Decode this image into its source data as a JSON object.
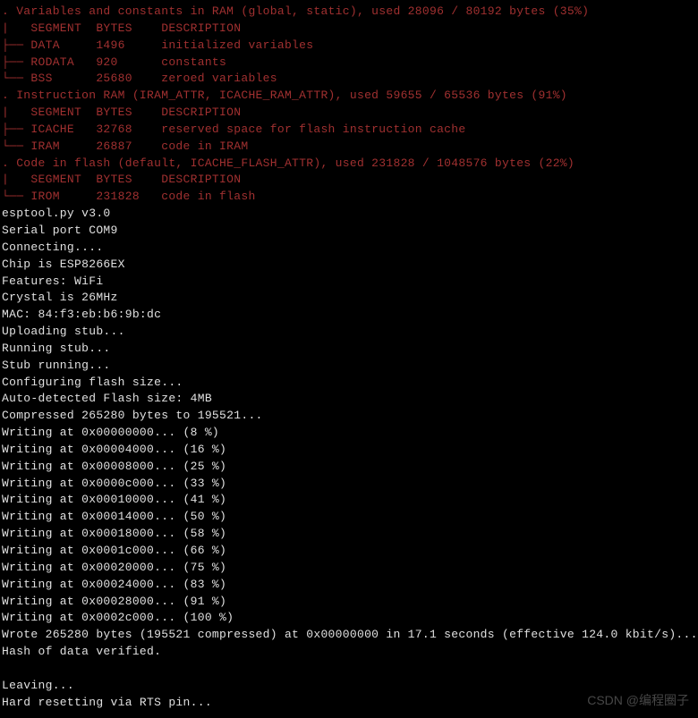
{
  "sections": [
    {
      "header": ". Variables and constants in RAM (global, static), used 28096 / 80192 bytes (35%)",
      "pipe": "|   SEGMENT  BYTES    DESCRIPTION",
      "rows": [
        {
          "prefix": "├── ",
          "seg": "DATA",
          "bytes": "1496",
          "desc": "initialized variables"
        },
        {
          "prefix": "├── ",
          "seg": "RODATA",
          "bytes": "920",
          "desc": "constants"
        },
        {
          "prefix": "└── ",
          "seg": "BSS",
          "bytes": "25680",
          "desc": "zeroed variables"
        }
      ]
    },
    {
      "header": ". Instruction RAM (IRAM_ATTR, ICACHE_RAM_ATTR), used 59655 / 65536 bytes (91%)",
      "pipe": "|   SEGMENT  BYTES    DESCRIPTION",
      "rows": [
        {
          "prefix": "├── ",
          "seg": "ICACHE",
          "bytes": "32768",
          "desc": "reserved space for flash instruction cache"
        },
        {
          "prefix": "└── ",
          "seg": "IRAM",
          "bytes": "26887",
          "desc": "code in IRAM"
        }
      ]
    },
    {
      "header": ". Code in flash (default, ICACHE_FLASH_ATTR), used 231828 / 1048576 bytes (22%)",
      "pipe": "|   SEGMENT  BYTES    DESCRIPTION",
      "rows": [
        {
          "prefix": "└── ",
          "seg": "IROM",
          "bytes": "231828",
          "desc": "code in flash"
        }
      ]
    }
  ],
  "output": [
    "esptool.py v3.0",
    "Serial port COM9",
    "Connecting....",
    "Chip is ESP8266EX",
    "Features: WiFi",
    "Crystal is 26MHz",
    "MAC: 84:f3:eb:b6:9b:dc",
    "Uploading stub...",
    "Running stub...",
    "Stub running...",
    "Configuring flash size...",
    "Auto-detected Flash size: 4MB",
    "Compressed 265280 bytes to 195521...",
    "Writing at 0x00000000... (8 %)",
    "Writing at 0x00004000... (16 %)",
    "Writing at 0x00008000... (25 %)",
    "Writing at 0x0000c000... (33 %)",
    "Writing at 0x00010000... (41 %)",
    "Writing at 0x00014000... (50 %)",
    "Writing at 0x00018000... (58 %)",
    "Writing at 0x0001c000... (66 %)",
    "Writing at 0x00020000... (75 %)",
    "Writing at 0x00024000... (83 %)",
    "Writing at 0x00028000... (91 %)",
    "Writing at 0x0002c000... (100 %)",
    "Wrote 265280 bytes (195521 compressed) at 0x00000000 in 17.1 seconds (effective 124.0 kbit/s)...",
    "Hash of data verified.",
    "",
    "Leaving...",
    "Hard resetting via RTS pin..."
  ],
  "watermark": "CSDN @编程圈子"
}
